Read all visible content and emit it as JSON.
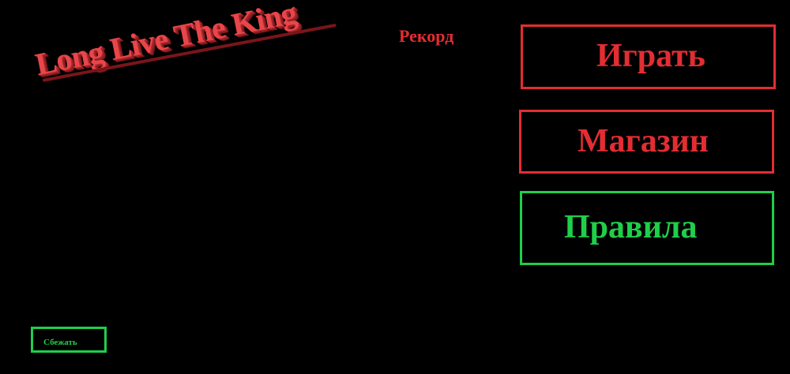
{
  "logo": {
    "text": "Long Live The King"
  },
  "record": {
    "label": "Рекорд"
  },
  "menu": {
    "play_label": "Играть",
    "shop_label": "Магазин",
    "rules_label": "Правила",
    "escape_label": "Сбежать"
  },
  "colors": {
    "background": "#000000",
    "red_accent": "#e22d32",
    "green_accent": "#1fcf4a",
    "logo_red": "#e8464a"
  }
}
